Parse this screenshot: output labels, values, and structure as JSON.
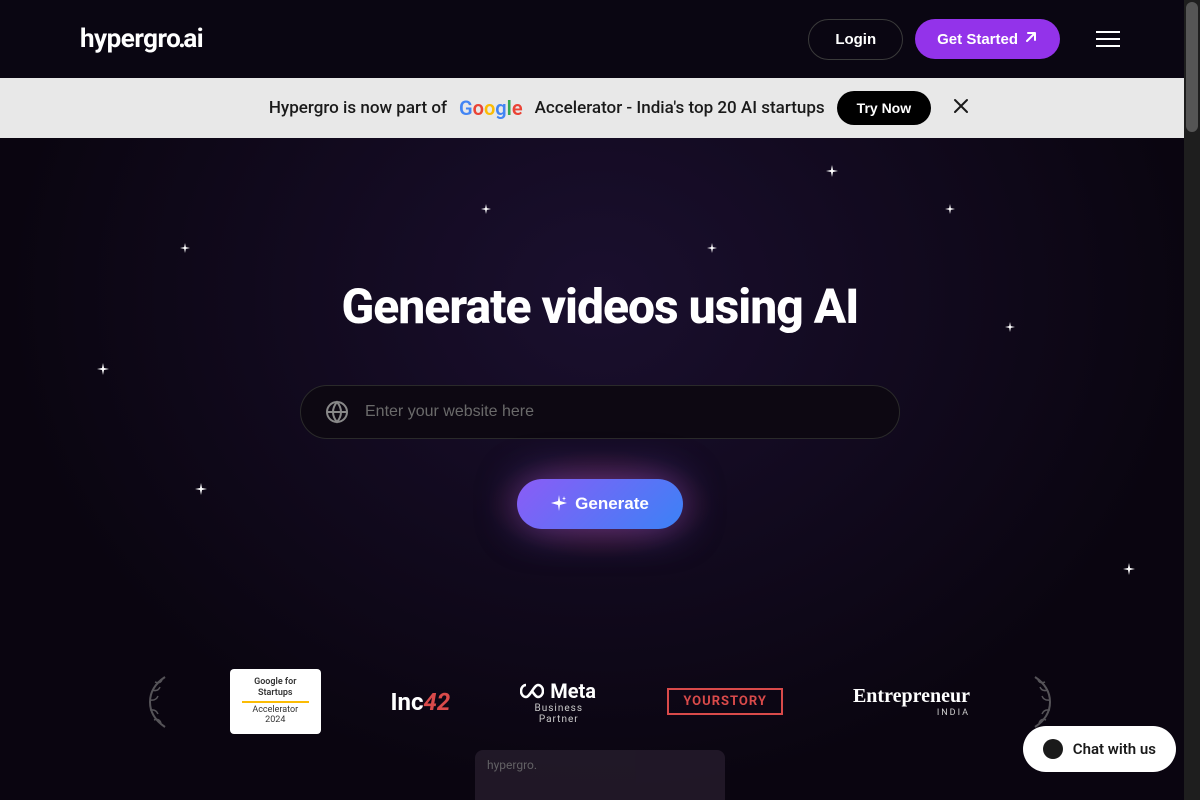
{
  "header": {
    "logo_text": "hypergro",
    "logo_suffix": "ai",
    "login_label": "Login",
    "get_started_label": "Get Started"
  },
  "announcement": {
    "text_before": "Hypergro is now part of",
    "text_after": "Accelerator - India's top 20 AI startups",
    "try_now_label": "Try Now"
  },
  "hero": {
    "title": "Generate videos using AI",
    "input_placeholder": "Enter your website here",
    "generate_label": "Generate"
  },
  "partners": {
    "google_badge_top": "Google for Startups",
    "google_badge_bottom": "Accelerator 2024",
    "inc42_text": "Inc",
    "inc42_num": "42",
    "meta_label": "Meta",
    "meta_sub": "Business Partner",
    "yourstory_label": "YOURSTORY",
    "entrepreneur_main": "Entrepreneur",
    "entrepreneur_sub": "INDIA"
  },
  "chat": {
    "label": "Chat with us"
  },
  "video_preview": {
    "logo": "hypergro."
  }
}
